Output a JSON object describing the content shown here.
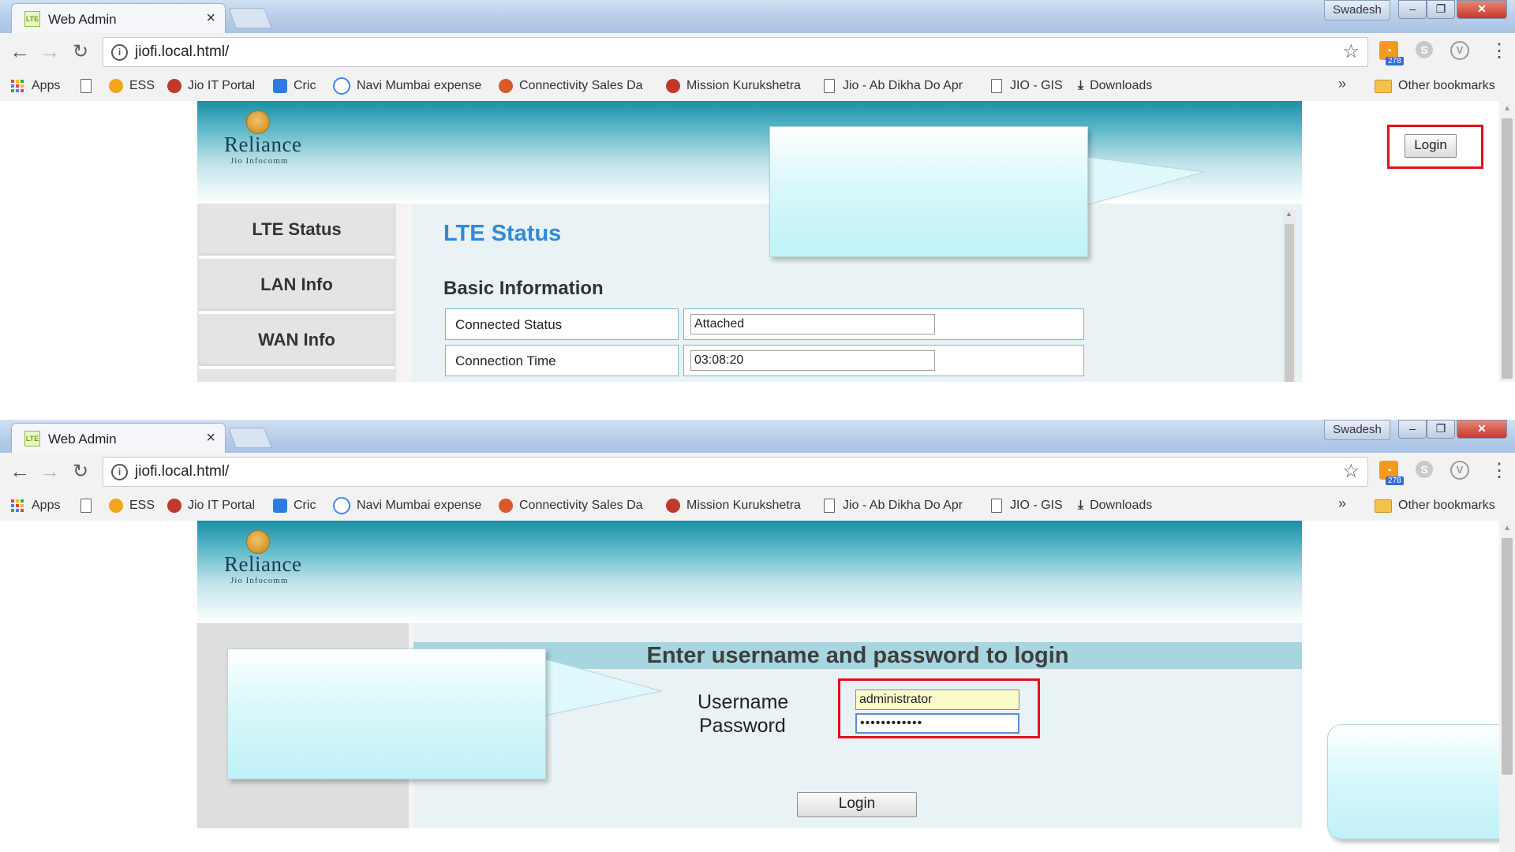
{
  "browser": {
    "tab_title": "Web Admin",
    "tab_favicon": "LTE",
    "tab_close": "×",
    "profile": "Swadesh",
    "window_controls": {
      "minimize": "–",
      "maximize": "❐",
      "close": "✕"
    },
    "url": "jiofi.local.html/",
    "extension_badge": "278",
    "bookmarks": [
      {
        "label": "Apps",
        "icon": "apps-grid-icon"
      },
      {
        "label": "",
        "icon": "page-icon"
      },
      {
        "label": "ESS",
        "icon": "ess-icon",
        "color": "#f2a51a"
      },
      {
        "label": "Jio IT Portal",
        "icon": "jio-it-portal-icon",
        "color": "#c0392b"
      },
      {
        "label": "Cric",
        "icon": "cric-icon",
        "color": "#2d7be0"
      },
      {
        "label": "Navi Mumbai expense",
        "icon": "google-icon",
        "color": "#4285f4"
      },
      {
        "label": "Connectivity Sales Da",
        "icon": "connectivity-icon",
        "color": "#d85a2b"
      },
      {
        "label": "Mission Kurukshetra",
        "icon": "mission-icon",
        "color": "#c0392b"
      },
      {
        "label": "Jio - Ab Dikha Do Apr",
        "icon": "page-icon"
      },
      {
        "label": "JIO - GIS",
        "icon": "page-icon"
      },
      {
        "label": "Downloads",
        "icon": "download-icon"
      }
    ],
    "more": "»",
    "other_bookmarks": "Other bookmarks"
  },
  "header": {
    "logo_text": "Reliance",
    "logo_sub": "Jio Infocomm",
    "login_button": "Login"
  },
  "lte_screen": {
    "nav": [
      "LTE Status",
      "LAN Info",
      "WAN Info"
    ],
    "title": "LTE Status",
    "section": "Basic Information",
    "rows": [
      {
        "label": "Connected Status",
        "value": "Attached"
      },
      {
        "label": "Connection Time",
        "value": "03:08:20"
      }
    ]
  },
  "login_screen": {
    "banner": "Enter username and password to login",
    "username_label": "Username",
    "password_label": "Password",
    "username_value": "administrator",
    "password_value": "••••••••••••",
    "login_button": "Login"
  },
  "colors": {
    "accent_blue": "#2f8ad8",
    "highlight_red": "#e0121d",
    "header_teal": "#1b8fa6",
    "callout_cyan": "#bff2f7"
  }
}
